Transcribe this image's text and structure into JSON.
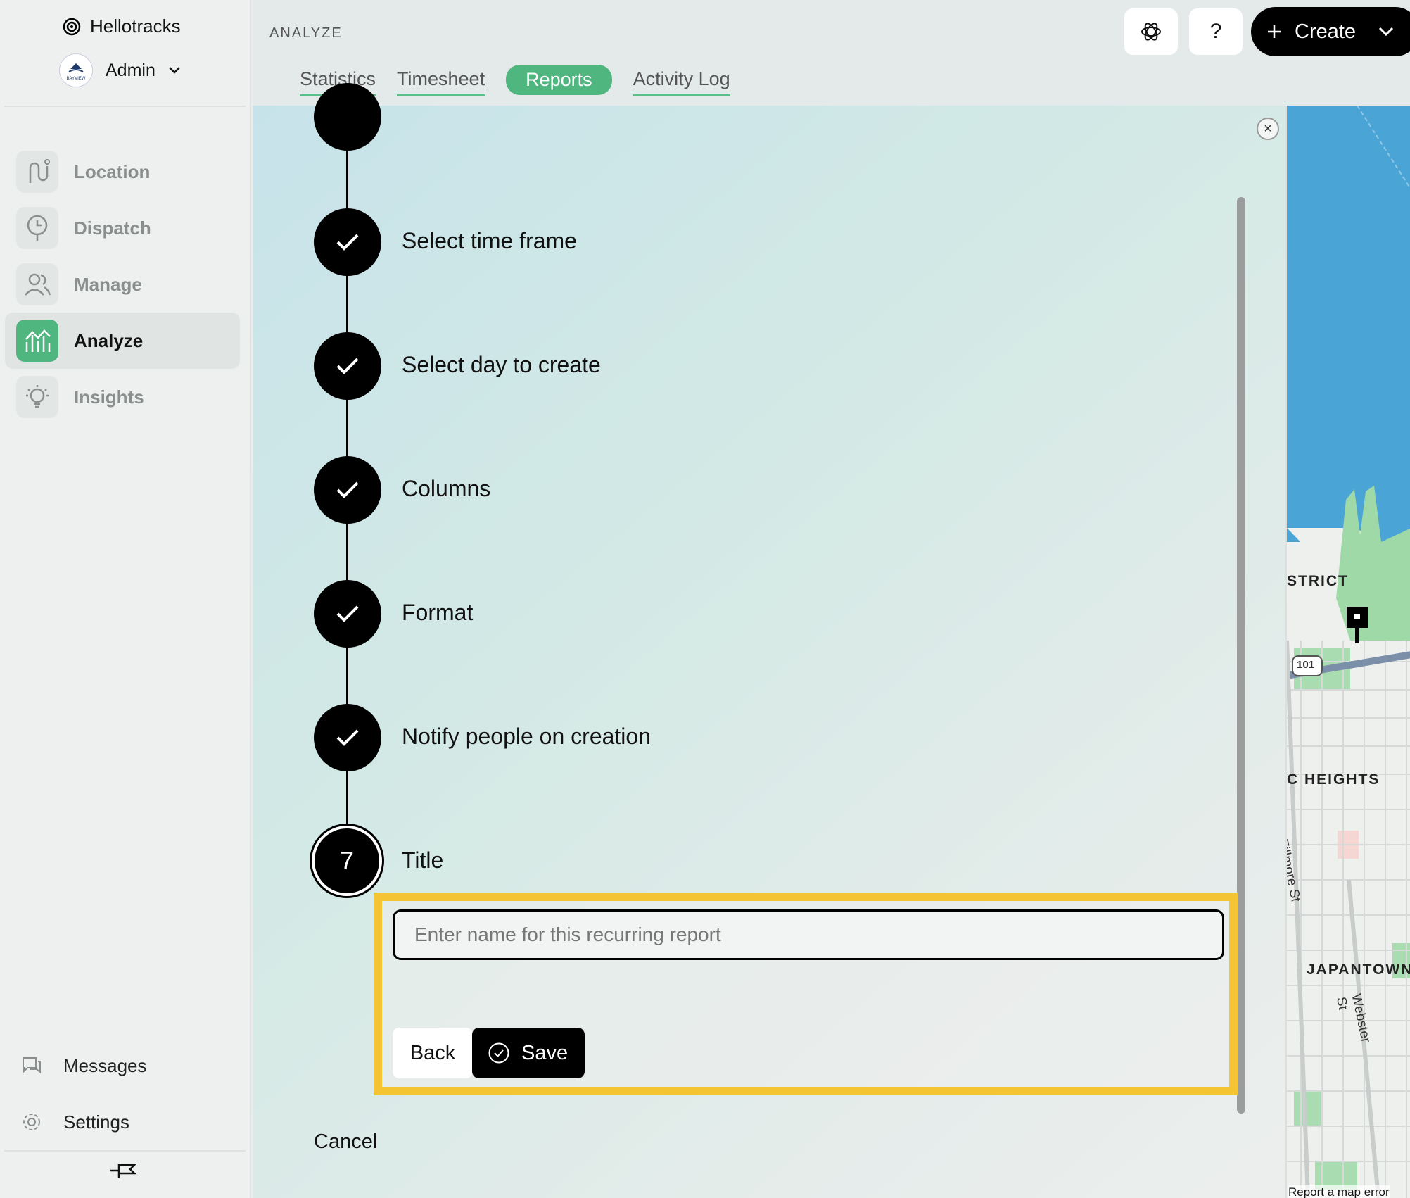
{
  "sidebar": {
    "brand_name": "Hellotracks",
    "account_name": "Admin",
    "avatar_text": "BAYVIEW",
    "nav": [
      {
        "label": "Location",
        "icon": "route-icon"
      },
      {
        "label": "Dispatch",
        "icon": "dispatch-icon"
      },
      {
        "label": "Manage",
        "icon": "people-icon"
      },
      {
        "label": "Analyze",
        "icon": "chart-icon",
        "active": true
      },
      {
        "label": "Insights",
        "icon": "lightbulb-icon"
      }
    ],
    "bottom": [
      {
        "label": "Messages",
        "icon": "chat-icon"
      },
      {
        "label": "Settings",
        "icon": "gear-icon"
      }
    ]
  },
  "header": {
    "section": "ANALYZE",
    "tabs": [
      "Statistics",
      "Timesheet",
      "Reports",
      "Activity Log"
    ],
    "active_tab": "Reports",
    "help_label": "?",
    "create_label": "Create"
  },
  "wizard": {
    "steps": [
      {
        "label": "Select time frame",
        "status": "done"
      },
      {
        "label": "Select day to create",
        "status": "done"
      },
      {
        "label": "Columns",
        "status": "done"
      },
      {
        "label": "Format",
        "status": "done"
      },
      {
        "label": "Notify people on creation",
        "status": "done"
      },
      {
        "label": "Title",
        "status": "current",
        "number": "7"
      }
    ],
    "title_placeholder": "Enter name for this recurring report",
    "title_value": "",
    "back_label": "Back",
    "save_label": "Save",
    "cancel_label": "Cancel"
  },
  "map": {
    "labels": [
      "STRICT",
      "C HEIGHTS",
      "Fillmore St",
      "JAPANTOWN",
      "Webster St"
    ],
    "highway": "101",
    "footer": "Report a map error"
  },
  "colors": {
    "accent": "#4fb680",
    "highlight": "#f4c433",
    "water": "#4aa5d6",
    "park": "#9fd9a8"
  }
}
